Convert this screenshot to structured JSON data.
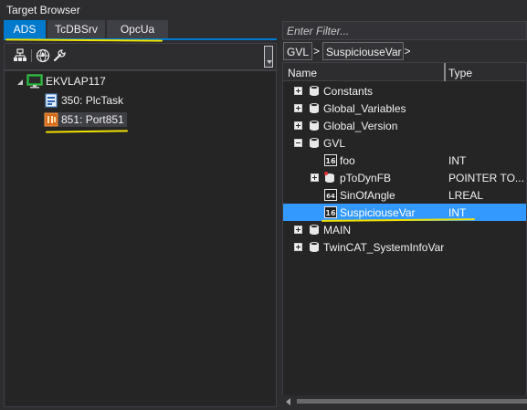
{
  "window": {
    "title": "Target Browser"
  },
  "tabs": [
    {
      "label": "ADS",
      "active": true
    },
    {
      "label": "TcDBSrv",
      "active": false
    },
    {
      "label": "OpcUa",
      "active": false
    }
  ],
  "toolbar": {
    "buttons": [
      "network-tree-icon",
      "globe-icon",
      "wrench-icon"
    ]
  },
  "left_tree": {
    "root": {
      "label": "EKVLAP117",
      "icon": "monitor-icon"
    },
    "children": [
      {
        "label": "350: PlcTask",
        "icon": "task-icon"
      },
      {
        "label": "851: Port851",
        "icon": "plc-port-icon",
        "selected": true
      }
    ]
  },
  "filter": {
    "placeholder": "Enter Filter..."
  },
  "breadcrumb": [
    {
      "label": "GVL",
      "separator": ">"
    },
    {
      "label": "SuspiciouseVar",
      "separator": ">"
    }
  ],
  "grid": {
    "columns": {
      "name": "Name",
      "type": "Type"
    },
    "rows": [
      {
        "name": "Constants",
        "type": "",
        "expander": "plus",
        "icon": "global-list-icon"
      },
      {
        "name": "Global_Variables",
        "type": "",
        "expander": "plus",
        "icon": "global-list-icon"
      },
      {
        "name": "Global_Version",
        "type": "",
        "expander": "plus",
        "icon": "global-list-icon"
      },
      {
        "name": "GVL",
        "type": "",
        "expander": "minus",
        "icon": "global-list-icon"
      },
      {
        "name": "foo",
        "type": "INT",
        "icon": "int16-icon"
      },
      {
        "name": "pToDynFB",
        "type": "POINTER TO...",
        "expander": "plus",
        "icon": "pointer-icon"
      },
      {
        "name": "SinOfAngle",
        "type": "LREAL",
        "icon": "lreal-icon"
      },
      {
        "name": "SuspiciouseVar",
        "type": "INT",
        "icon": "int16-icon",
        "selected": true
      },
      {
        "name": "MAIN",
        "type": "",
        "expander": "plus",
        "icon": "global-list-icon"
      },
      {
        "name": "TwinCAT_SystemInfoVar",
        "type": "",
        "expander": "plus",
        "icon": "global-list-icon"
      }
    ]
  },
  "colors": {
    "accent": "#007acc",
    "selection": "#3399ff",
    "annotation": "#f2e200",
    "background": "#252526"
  }
}
